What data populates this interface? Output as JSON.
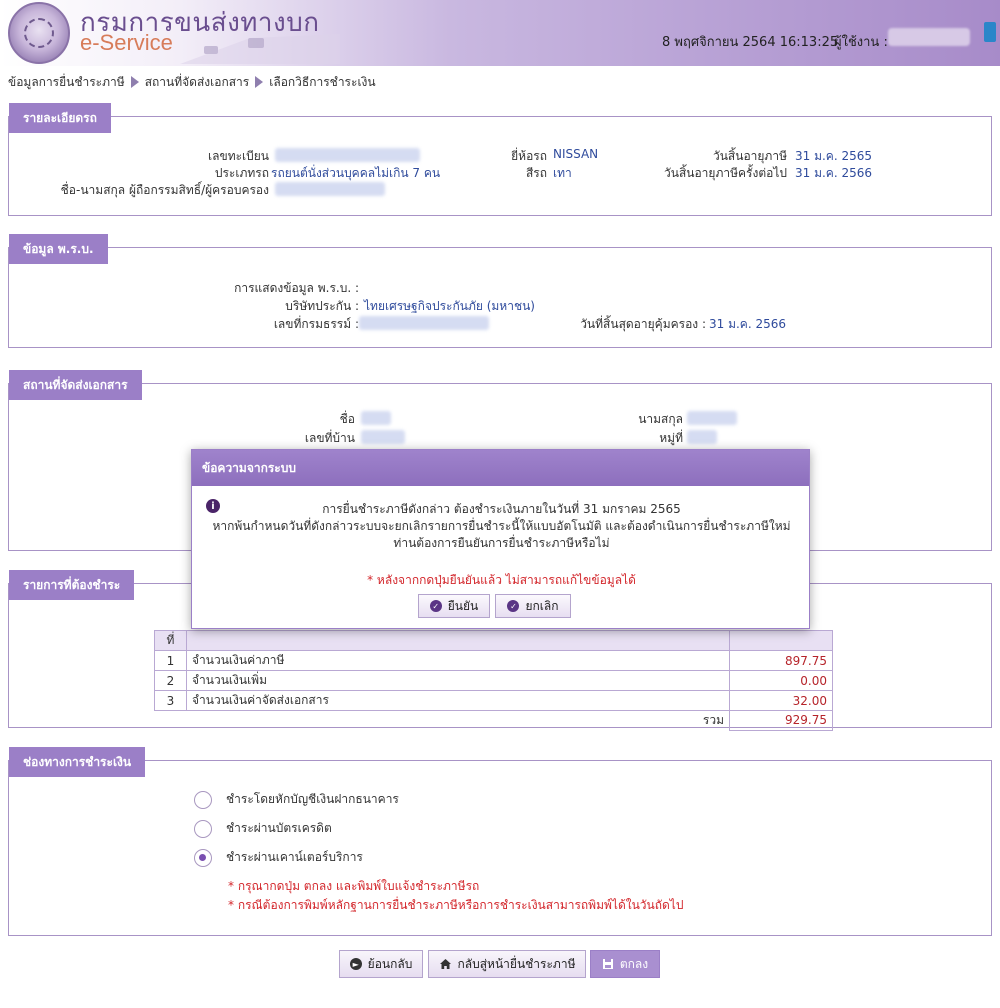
{
  "header": {
    "brand_thai": "กรมการขนส่งทางบก",
    "brand_eservice": "e-Service",
    "datetime": "8 พฤศจิกายน 2564 16:13:25",
    "user_label": "ผู้ใช้งาน :"
  },
  "breadcrumb": [
    "ข้อมูลการยื่นชำระภาษี",
    "สถานที่จัดส่งเอกสาร",
    "เลือกวิธีการชำระเงิน"
  ],
  "vehicle": {
    "title": "รายละเอียดรถ",
    "reg_label": "เลขทะเบียน",
    "type_label": "ประเภทรถ",
    "type_value": "รถยนต์นั่งส่วนบุคคลไม่เกิน 7 คน",
    "owner_label": "ชื่อ-นามสกุล ผู้ถือกรรมสิทธิ์/ผู้ครอบครอง",
    "brand_label": "ยี่ห้อรถ",
    "brand_value": "NISSAN",
    "color_label": "สีรถ",
    "color_value": "เทา",
    "tax_expire_label": "วันสิ้นอายุภาษี",
    "tax_expire_value": "31 ม.ค. 2565",
    "next_tax_expire_label": "วันสิ้นอายุภาษีครั้งต่อไป",
    "next_tax_expire_value": "31 ม.ค. 2566"
  },
  "insurance": {
    "title": "ข้อมูล พ.ร.บ.",
    "display_label": "การแสดงข้อมูล พ.ร.บ. :",
    "company_label": "บริษัทประกัน :",
    "company_value": "ไทยเศรษฐกิจประกันภัย (มหาชน)",
    "policy_label": "เลขที่กรมธรรม์ :",
    "coverage_expire_label": "วันที่สิ้นสุดอายุคุ้มครอง :",
    "coverage_expire_value": "31 ม.ค. 2566"
  },
  "delivery": {
    "title": "สถานที่จัดส่งเอกสาร",
    "first_name_label": "ชื่อ",
    "last_name_label": "นามสกุล",
    "house_no_label": "เลขที่บ้าน",
    "moo_label": "หมู่ที่"
  },
  "payment_items": {
    "title": "รายการที่ต้องชำระ",
    "col_no": "ที่",
    "rows": [
      {
        "no": "1",
        "desc": "จำนวนเงินค่าภาษี",
        "amount": "897.75"
      },
      {
        "no": "2",
        "desc": "จำนวนเงินเพิ่ม",
        "amount": "0.00"
      },
      {
        "no": "3",
        "desc": "จำนวนเงินค่าจัดส่งเอกสาร",
        "amount": "32.00"
      }
    ],
    "total_label": "รวม",
    "total_value": "929.75"
  },
  "channels": {
    "title": "ช่องทางการชำระเงิน",
    "options": [
      {
        "label": "ชำระโดยหักบัญชีเงินฝากธนาคาร",
        "selected": false
      },
      {
        "label": "ชำระผ่านบัตรเครดิต",
        "selected": false
      },
      {
        "label": "ชำระผ่านเคาน์เตอร์บริการ",
        "selected": true
      }
    ],
    "note1": "* กรุณากดปุ่ม ตกลง และพิมพ์ใบแจ้งชำระภาษีรถ",
    "note2": "* กรณีต้องการพิมพ์หลักฐานการยื่นชำระภาษีหรือการชำระเงินสามารถพิมพ์ได้ในวันถัดไป"
  },
  "footer": {
    "back_label": "ย้อนกลับ",
    "home_label": "กลับสู่หน้ายื่นชำระภาษี",
    "ok_label": "ตกลง"
  },
  "modal": {
    "title": "ข้อความจากระบบ",
    "line1": "การยื่นชำระภาษีดังกล่าว ต้องชำระเงินภายในวันที่ 31 มกราคม 2565",
    "line2": "หากพ้นกำหนดวันที่ดังกล่าวระบบจะยกเลิกรายการยื่นชำระนี้ให้แบบอัตโนมัติ และต้องดำเนินการยื่นชำระภาษีใหม่",
    "line3": "ท่านต้องการยืนยันการยื่นชำระภาษีหรือไม่",
    "warning": "* หลังจากกดปุ่มยืนยันแล้ว ไม่สามารถแก้ไขข้อมูลได้",
    "confirm_label": "ยืนยัน",
    "cancel_label": "ยกเลิก"
  },
  "colors": {
    "accent": "#9b7fc7",
    "link_blue": "#2f4b9c",
    "alert_red": "#d3262b"
  }
}
